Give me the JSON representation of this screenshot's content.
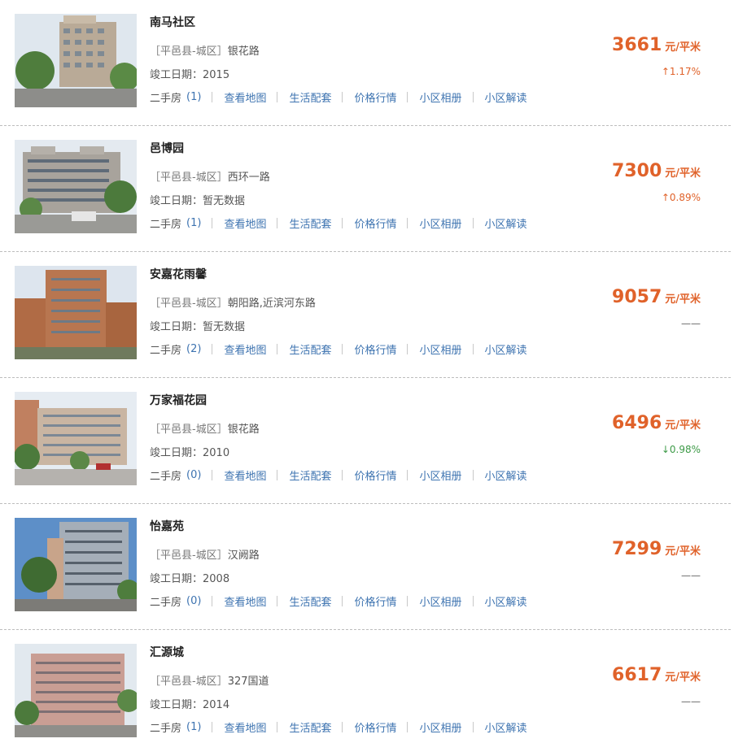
{
  "labels": {
    "built_prefix": "竣工日期：",
    "second_hand": "二手房",
    "view_map": "查看地图",
    "amenities": "生活配套",
    "price_trend": "价格行情",
    "album": "小区相册",
    "interpretation": "小区解读",
    "price_unit": "元/平米"
  },
  "colors": {
    "price": "#e0622a",
    "link": "#3d73b0",
    "trend_down": "#3d9a47"
  },
  "communities": [
    {
      "name": "南马社区",
      "district": "［平邑县-城区］",
      "road": "银花路",
      "built": "2015",
      "listings": "(1)",
      "price": "3661",
      "trend": "↑1.17%",
      "trend_dir": "up"
    },
    {
      "name": "邑博园",
      "district": "［平邑县-城区］",
      "road": "西环一路",
      "built": "暂无数据",
      "listings": "(1)",
      "price": "7300",
      "trend": "↑0.89%",
      "trend_dir": "up"
    },
    {
      "name": "安嘉花雨馨",
      "district": "［平邑县-城区］",
      "road": "朝阳路,近滨河东路",
      "built": "暂无数据",
      "listings": "(2)",
      "price": "9057",
      "trend": "——",
      "trend_dir": "flat"
    },
    {
      "name": "万家福花园",
      "district": "［平邑县-城区］",
      "road": "银花路",
      "built": "2010",
      "listings": "(0)",
      "price": "6496",
      "trend": "↓0.98%",
      "trend_dir": "down"
    },
    {
      "name": "怡嘉苑",
      "district": "［平邑县-城区］",
      "road": "汉阙路",
      "built": "2008",
      "listings": "(0)",
      "price": "7299",
      "trend": "——",
      "trend_dir": "flat"
    },
    {
      "name": "汇源城",
      "district": "［平邑县-城区］",
      "road": "327国道",
      "built": "2014",
      "listings": "(1)",
      "price": "6617",
      "trend": "——",
      "trend_dir": "flat"
    }
  ]
}
